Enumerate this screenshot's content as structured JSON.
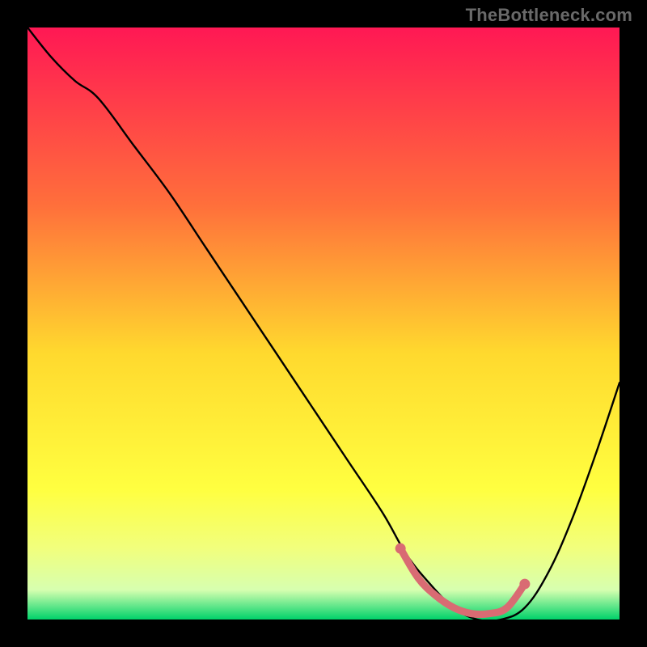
{
  "attribution": "TheBottleneck.com",
  "colors": {
    "background": "#000000",
    "attribution_text": "#696969",
    "curve": "#000000",
    "marker_fill": "#d96b73",
    "marker_stroke": "#d96b73",
    "gradient_top": "#ff1854",
    "gradient_mid1": "#ff6f3b",
    "gradient_mid2": "#ffd92e",
    "gradient_mid3": "#ffff40",
    "gradient_mid4": "#f1ff7d",
    "gradient_mid5": "#d7ffb0",
    "gradient_bottom": "#00d26a"
  },
  "chart_data": {
    "type": "line",
    "title": "",
    "xlabel": "",
    "ylabel": "",
    "xlim": [
      0,
      100
    ],
    "ylim": [
      0,
      100
    ],
    "series": [
      {
        "name": "bottleneck-curve",
        "x": [
          0,
          4,
          8,
          12,
          18,
          24,
          30,
          36,
          42,
          48,
          54,
          60,
          64,
          68,
          72,
          76,
          80,
          84,
          88,
          92,
          96,
          100
        ],
        "values": [
          100,
          95,
          91,
          88,
          80,
          72,
          63,
          54,
          45,
          36,
          27,
          18,
          11,
          6,
          2,
          0,
          0,
          2,
          8,
          17,
          28,
          40
        ]
      }
    ],
    "markers": {
      "name": "optimal-range",
      "x": [
        63,
        66,
        69,
        72,
        75,
        78,
        81,
        84
      ],
      "values": [
        12,
        7,
        4,
        2,
        1,
        1,
        2,
        6
      ]
    }
  }
}
